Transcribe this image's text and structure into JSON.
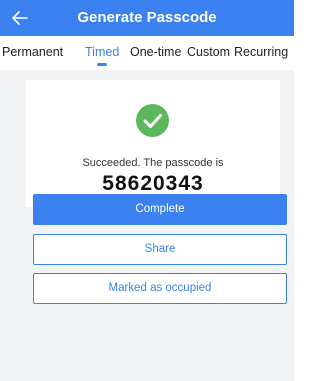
{
  "header": {
    "title": "Generate Passcode",
    "back_icon": "arrow-left-icon"
  },
  "tabs": [
    {
      "label": "Permanent",
      "active": false
    },
    {
      "label": "Timed",
      "active": true
    },
    {
      "label": "One-time",
      "active": false
    },
    {
      "label": "Custom",
      "active": false
    },
    {
      "label": "Recurring",
      "active": false
    }
  ],
  "result": {
    "icon": "check-circle-icon",
    "message": "Succeeded. The passcode is",
    "passcode": "58620343"
  },
  "buttons": {
    "complete": "Complete",
    "share": "Share",
    "occupied": "Marked as occupied"
  },
  "colors": {
    "accent": "#3b82f0",
    "success": "#5cb85c",
    "background": "#f2f3f5"
  }
}
